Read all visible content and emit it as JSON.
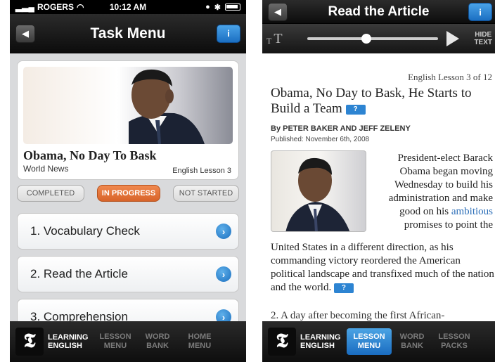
{
  "left": {
    "status": {
      "carrier": "ROGERS",
      "time": "10:12 AM"
    },
    "nav": {
      "title": "Task Menu",
      "back": "◀",
      "info": "i"
    },
    "card": {
      "title": "Obama, No Day To Bask",
      "category": "World News",
      "lesson": "English Lesson 3"
    },
    "filters": [
      "COMPLETED",
      "IN PROGRESS",
      "NOT STARTED"
    ],
    "tasks": [
      "1. Vocabulary Check",
      "2. Read the Article",
      "3. Comprehension"
    ],
    "tabbar": {
      "logo": "𝕿",
      "brand_line1": "LEARNING",
      "brand_line2": "ENGLISH",
      "tabs": [
        {
          "l1": "LESSON",
          "l2": "MENU"
        },
        {
          "l1": "WORD",
          "l2": "BANK"
        },
        {
          "l1": "HOME",
          "l2": "MENU"
        }
      ]
    }
  },
  "right": {
    "nav": {
      "title": "Read the Article",
      "back": "◀",
      "info": "i"
    },
    "player": {
      "small_t": "T",
      "big_t": "T",
      "hide_l1": "HIDE",
      "hide_l2": "TEXT",
      "position": 0.45
    },
    "lesson": "English Lesson 3 of 12",
    "headline": "Obama, No Day to Bask, He Starts to Build a Team",
    "byline": "By PETER BAKER AND JEFF ZELENY",
    "published": "Published: November 6th, 2008",
    "p1_before": "President-elect Barack Obama began moving Wednesday to build his administration and make good on his ",
    "p1_link": "ambitious",
    "p1_after": " promises to point the",
    "p2": "United States in a different direction, as his commanding victory reordered the American political landscape and transfixed much of the nation and the world.",
    "p3": "2. A day after becoming the first African-",
    "help": "?",
    "tabbar": {
      "logo": "𝕿",
      "brand_line1": "LEARNING",
      "brand_line2": "ENGLISH",
      "tabs": [
        {
          "l1": "LESSON",
          "l2": "MENU"
        },
        {
          "l1": "WORD",
          "l2": "BANK"
        },
        {
          "l1": "LESSON",
          "l2": "PACKS"
        }
      ]
    }
  },
  "colors": {
    "accent_blue": "#2d84d2",
    "in_progress_orange": "#e2723a"
  }
}
